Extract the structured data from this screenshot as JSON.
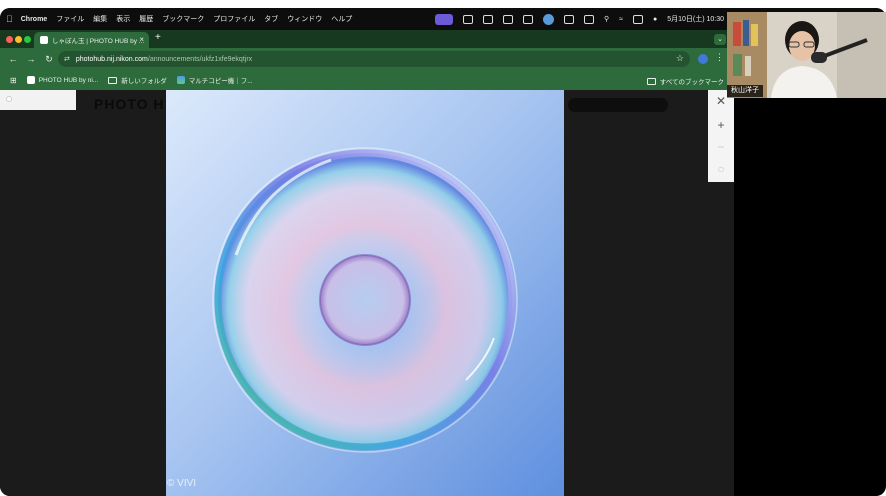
{
  "menubar": {
    "app_name": "Chrome",
    "items": [
      "ファイル",
      "編集",
      "表示",
      "履歴",
      "ブックマーク",
      "プロファイル",
      "タブ",
      "ウィンドウ",
      "ヘルプ"
    ],
    "datetime": "5月10日(土) 10:30"
  },
  "browser": {
    "tab_title": "しゃぼん玉 | PHOTO HUB by ...",
    "new_tab_symbol": "+",
    "address_host": "photohub.nij.nikon.com",
    "address_path": "/announcements/ukfz1xfe9ekqtjrx",
    "bookmarks": [
      "PHOTO HUB by ni...",
      "新しいフォルダ",
      "マルチコピー機｜フ..."
    ],
    "all_bookmarks": "すべてのブックマーク"
  },
  "page": {
    "ghost_title": "PHOTO H",
    "photo_credit": "© VIVI"
  },
  "viewer": {
    "close_symbol": "✕",
    "zoom_in_symbol": "+",
    "zoom_out_symbol": "−",
    "reset_symbol": "○"
  },
  "camera_overlay": {
    "person_name": "秋山洋子"
  },
  "colors": {
    "tab_green": "#2d6a3c",
    "bubble_sky": "#7aa7e6"
  }
}
